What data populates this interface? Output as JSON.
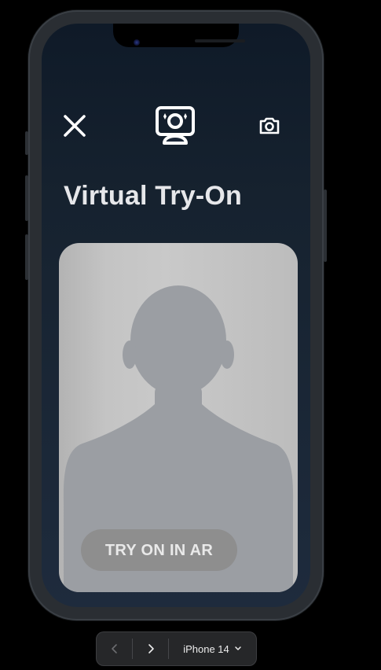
{
  "screen": {
    "title": "Virtual Try-On",
    "toolbar": {
      "close_icon": "close-icon",
      "face_scan_icon": "face-scan-icon",
      "camera_icon": "camera-icon"
    },
    "preview": {
      "placeholder_icon": "person-silhouette",
      "ar_button_label": "TRY ON IN AR"
    }
  },
  "device_toolbar": {
    "back_icon": "chevron-left-icon",
    "forward_icon": "chevron-right-icon",
    "device_name": "iPhone 14",
    "dropdown_icon": "chevron-down-icon"
  },
  "colors": {
    "screen_bg": "#16222f",
    "title_text": "#e6e7ea",
    "preview_bg": "#c4c4c4",
    "silhouette": "#9b9ea3",
    "ar_button_bg": "#8e8e8e"
  }
}
